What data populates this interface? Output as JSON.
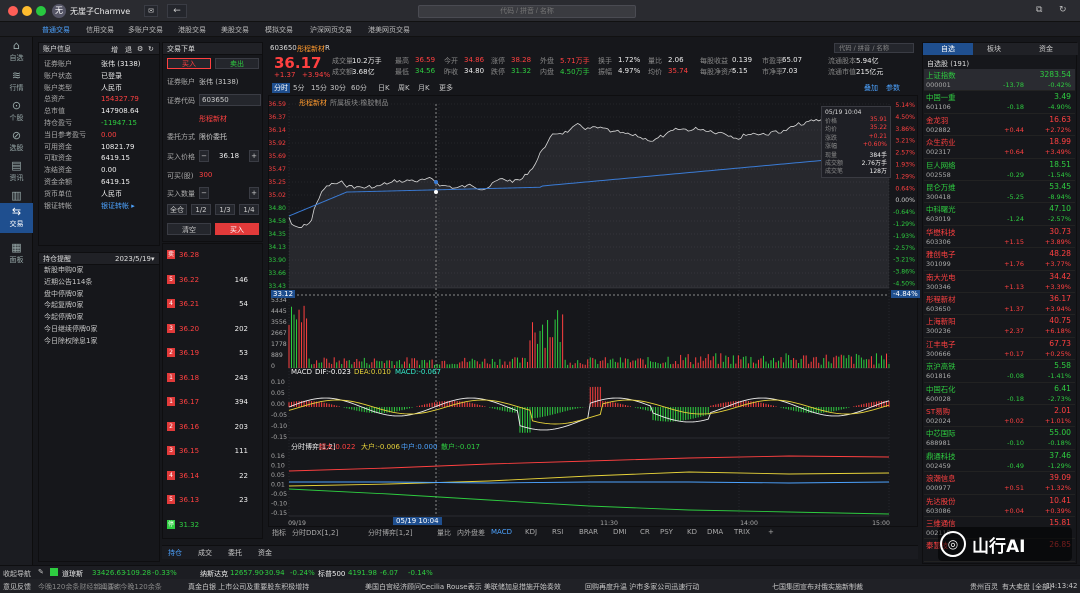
{
  "titlebar": {
    "user": "无崖子Charmve",
    "search_placeholder": "代码 / 拼音 / 名称"
  },
  "nav_tabs": [
    "普通交易",
    "信用交易",
    "多账户交易",
    "港股交易",
    "美股交易",
    "模拟交易",
    "沪深网页交易",
    "港美网页交易"
  ],
  "rail": [
    {
      "icon": "⌂",
      "label": "自选"
    },
    {
      "icon": "≋",
      "label": "行情"
    },
    {
      "icon": "⊙",
      "label": "个股"
    },
    {
      "icon": "⊘",
      "label": "选股"
    },
    {
      "icon": "▤",
      "label": "资讯"
    },
    {
      "icon": "▥",
      "label": "数据"
    },
    {
      "icon": "⇆",
      "label": "交易"
    },
    {
      "icon": "▦",
      "label": "面板"
    }
  ],
  "account": {
    "title": "账户信息",
    "actions": [
      "增",
      "退"
    ],
    "rows": [
      [
        "证券账户",
        "张伟 (3138)"
      ],
      [
        "账户状态",
        "已登录"
      ],
      [
        "账户类型",
        "人民币"
      ],
      [
        "总资产",
        "154327.79"
      ],
      [
        "总市值",
        "147908.64"
      ],
      [
        "持仓盈亏",
        "-11947.15"
      ],
      [
        "当日参考盈亏",
        "0.00"
      ],
      [
        "可用资金",
        "10821.79"
      ],
      [
        "可取资金",
        "6419.15"
      ],
      [
        "冻结资金",
        "0.00"
      ],
      [
        "资金余额",
        "6419.15"
      ],
      [
        "货币单位",
        "人民币"
      ],
      [
        "银证转帐",
        "银证转帐 ▸"
      ]
    ]
  },
  "reminders": {
    "title": "持仓提醒",
    "date": "2023/5/19",
    "items": [
      "新股申购0家",
      "近期公告114条",
      "盘中停牌0家",
      "今起复牌0家",
      "今起停牌0家",
      "今日继续停牌0家",
      "今日除权除息1家"
    ]
  },
  "order": {
    "title": "交易下单",
    "buy_tab": "买入",
    "sell_tab": "卖出",
    "account_label": "证券账户",
    "account": "张伟 (3138)",
    "code_label": "证券代码",
    "code": "603650",
    "name": "彤程新材",
    "type_label": "委托方式",
    "type": "限价委托",
    "price_label": "买入价格",
    "price": "36.18",
    "avail_label": "可买(股)",
    "avail": "300",
    "qty_label": "买入数量",
    "qty_btns": [
      "全仓",
      "1/2",
      "1/3",
      "1/4"
    ],
    "clear": "清空",
    "submit": "买入"
  },
  "orderbook": [
    {
      "q": "卖",
      "p": "36.28",
      "v": "",
      "c": "red"
    },
    {
      "q": "5",
      "p": "36.22",
      "v": "146",
      "c": "red"
    },
    {
      "q": "4",
      "p": "36.21",
      "v": "54",
      "c": "red"
    },
    {
      "q": "3",
      "p": "36.20",
      "v": "202",
      "c": "red"
    },
    {
      "q": "2",
      "p": "36.19",
      "v": "53",
      "c": "red"
    },
    {
      "q": "1",
      "p": "36.18",
      "v": "243",
      "c": "red"
    },
    {
      "q": "1",
      "p": "36.17",
      "v": "394",
      "c": "red"
    },
    {
      "q": "2",
      "p": "36.16",
      "v": "203",
      "c": "red"
    },
    {
      "q": "3",
      "p": "36.15",
      "v": "111",
      "c": "red"
    },
    {
      "q": "4",
      "p": "36.14",
      "v": "22",
      "c": "red"
    },
    {
      "q": "5",
      "p": "36.13",
      "v": "23",
      "c": "red"
    },
    {
      "q": "停",
      "p": "31.32",
      "v": "",
      "c": "green"
    }
  ],
  "quote": {
    "code": "603650",
    "name": "彤程新材",
    "suffix": "R",
    "price": "36.17",
    "change": "+1.37",
    "pct": "+3.94%",
    "fields": [
      [
        "成交量",
        "10.2万手"
      ],
      [
        "最高",
        "36.59"
      ],
      [
        "今开",
        "34.86"
      ],
      [
        "涨停",
        "38.28"
      ],
      [
        "外盘",
        "5.71万手"
      ],
      [
        "换手",
        "1.72%"
      ],
      [
        "量比",
        "2.06"
      ],
      [
        "每股收益",
        "0.139"
      ],
      [
        "市盈率",
        "65.07"
      ],
      [
        "流通股本",
        "5.94亿"
      ],
      [
        "成交额",
        "3.68亿"
      ],
      [
        "最低",
        "34.56"
      ],
      [
        "昨收",
        "34.80"
      ],
      [
        "跌停",
        "31.32"
      ],
      [
        "内盘",
        "4.50万手"
      ],
      [
        "振幅",
        "4.97%"
      ],
      [
        "均价",
        "35.74"
      ],
      [
        "每股净资产",
        "5.15"
      ],
      [
        "市净率",
        "7.03"
      ],
      [
        "流通市值",
        "215亿元"
      ]
    ]
  },
  "periods": [
    "分时",
    "5分",
    "15分",
    "30分",
    "60分",
    "日K",
    "周K",
    "月K",
    "更多"
  ],
  "chart_links": [
    "叠加",
    "参数"
  ],
  "chart_title": "彤程新材",
  "chart_subtitle": "所属板块:橡胶制品",
  "tooltip": {
    "date": "05/19 10:04",
    "rows": [
      [
        "价格",
        "35.91"
      ],
      [
        "均价",
        "35.22"
      ],
      [
        "涨跌",
        "+0.21"
      ],
      [
        "涨幅",
        "+0.60%"
      ],
      [
        "现量",
        "384手"
      ],
      [
        "成交额",
        "2.76万手"
      ],
      [
        "成交笔",
        "128万"
      ]
    ]
  },
  "price_ticks": [
    "36.59",
    "36.37",
    "36.14",
    "35.92",
    "35.69",
    "35.47",
    "35.25",
    "35.02",
    "34.80",
    "34.58",
    "34.35",
    "34.13",
    "33.90",
    "33.66",
    "33.43"
  ],
  "pct_ticks": [
    "5.14%",
    "4.50%",
    "3.86%",
    "3.21%",
    "2.57%",
    "1.93%",
    "1.29%",
    "0.64%",
    "0.00%",
    "-0.64%",
    "-1.29%",
    "-1.93%",
    "-2.57%",
    "-3.21%",
    "-3.86%",
    "-4.50%"
  ],
  "cursor_price": "33.12",
  "cursor_pct": "-4.84%",
  "vol_ticks": [
    "5334",
    "4445",
    "3556",
    "2667",
    "1778",
    "889",
    "0"
  ],
  "macd": {
    "label": "MACD",
    "dif": "DIF:-0.023",
    "dea": "DEA:0.010",
    "macd": "MACD:-0.067",
    "ticks": [
      "0.10",
      "0.05",
      "0.00",
      "-0.05",
      "-0.10",
      "-0.15"
    ]
  },
  "fund": {
    "label": "分时博弈[1,2]",
    "a": "超大:0.022",
    "b": "大户:-0.006",
    "c": "中户:0.000",
    "d": "散户:-0.017",
    "ticks": [
      "0.16",
      "0.10",
      "0.05",
      "0.01",
      "-0.05",
      "-0.10",
      "-0.15"
    ]
  },
  "time_axis": [
    "09/19",
    "10:04",
    "11:30",
    "14:00",
    "15:00"
  ],
  "time_cursor": "05/19 10:04",
  "indicator_tabs": [
    "指标",
    "分时DDX[1,2]",
    "分时博弈[1,2]",
    "量比",
    "内外盘差",
    "MACD",
    "KDJ",
    "RSI",
    "BRAR",
    "DMI",
    "CR",
    "PSY",
    "KD",
    "DMA",
    "TRIX",
    "+"
  ],
  "bottom_tabs": [
    "持仓",
    "成交",
    "委托",
    "资金"
  ],
  "watchlist": {
    "tabs": [
      "自选",
      "板块",
      "资金"
    ],
    "group": "自选股 (191)",
    "items": [
      {
        "n": "上证指数",
        "c": "000001",
        "p": "3283.54",
        "d": "-13.78",
        "r": "-0.42%",
        "col": "green"
      },
      {
        "n": "中国一重",
        "c": "601106",
        "p": "3.49",
        "d": "-0.18",
        "r": "-4.90%",
        "col": "green"
      },
      {
        "n": "金龙羽",
        "c": "002882",
        "p": "16.63",
        "d": "+0.44",
        "r": "+2.72%",
        "col": "red"
      },
      {
        "n": "众生药业",
        "c": "002317",
        "p": "18.99",
        "d": "+0.64",
        "r": "+3.49%",
        "col": "red"
      },
      {
        "n": "巨人网络",
        "c": "002558",
        "p": "18.51",
        "d": "-0.29",
        "r": "-1.54%",
        "col": "green"
      },
      {
        "n": "昆仑万维",
        "c": "300418",
        "p": "53.45",
        "d": "-5.25",
        "r": "-8.94%",
        "col": "green"
      },
      {
        "n": "中科曙光",
        "c": "603019",
        "p": "47.10",
        "d": "-1.24",
        "r": "-2.57%",
        "col": "green"
      },
      {
        "n": "华懋科技",
        "c": "603306",
        "p": "30.73",
        "d": "+1.15",
        "r": "+3.89%",
        "col": "red"
      },
      {
        "n": "雅创电子",
        "c": "301099",
        "p": "48.28",
        "d": "+1.76",
        "r": "+3.77%",
        "col": "red"
      },
      {
        "n": "南大光电",
        "c": "300346",
        "p": "34.42",
        "d": "+1.13",
        "r": "+3.39%",
        "col": "red"
      },
      {
        "n": "彤程新材",
        "c": "603650",
        "p": "36.17",
        "d": "+1.37",
        "r": "+3.94%",
        "col": "red"
      },
      {
        "n": "上海新阳",
        "c": "300236",
        "p": "40.75",
        "d": "+2.37",
        "r": "+6.18%",
        "col": "red"
      },
      {
        "n": "江丰电子",
        "c": "300666",
        "p": "67.73",
        "d": "+0.17",
        "r": "+0.25%",
        "col": "red"
      },
      {
        "n": "京沪高铁",
        "c": "601816",
        "p": "5.58",
        "d": "-0.08",
        "r": "-1.41%",
        "col": "green"
      },
      {
        "n": "中国石化",
        "c": "600028",
        "p": "6.41",
        "d": "-0.18",
        "r": "-2.73%",
        "col": "green"
      },
      {
        "n": "ST易购",
        "c": "002024",
        "p": "2.01",
        "d": "+0.02",
        "r": "+1.01%",
        "col": "red"
      },
      {
        "n": "中芯国际",
        "c": "688981",
        "p": "55.00",
        "d": "-0.10",
        "r": "-0.18%",
        "col": "green"
      },
      {
        "n": "鼎通科技",
        "c": "002459",
        "p": "37.46",
        "d": "-0.49",
        "r": "-1.29%",
        "col": "green"
      },
      {
        "n": "浪潮信息",
        "c": "000977",
        "p": "39.09",
        "d": "+0.51",
        "r": "+1.32%",
        "col": "red"
      },
      {
        "n": "先达股份",
        "c": "603086",
        "p": "10.41",
        "d": "+0.04",
        "r": "+0.39%",
        "col": "red"
      },
      {
        "n": "三维通信",
        "c": "002115",
        "p": "15.81",
        "d": "",
        "r": "",
        "col": "red"
      },
      {
        "n": "泰慧技",
        "c": "",
        "p": "26.85",
        "d": "",
        "r": "",
        "col": "red"
      }
    ]
  },
  "watermark": "山行AI",
  "statusbar": {
    "label": "收起导航",
    "indices": [
      [
        "道琼斯",
        "33426.63",
        "-109.28",
        "-0.33%"
      ],
      [
        "纳斯达克",
        "12657.90",
        "-30.94",
        "-0.24%"
      ],
      [
        "标普500",
        "4191.98",
        "-6.07",
        "-0.14%"
      ]
    ]
  },
  "ticker": {
    "label": "意见反馈",
    "items": [
      "21:18 今晚120余条",
      "21:16 上市公司及重要股东",
      "20:53 回购",
      "13:56 七国集团",
      "13:54 日本内阁",
      "贵州百灵",
      "有大卖盘 [全部]"
    ],
    "news": [
      "今晚120余条财经新闻要点",
      "真金白银 上市公司及重要股东积极增持",
      "美国白宫经济顾问Cecilia Rouse表示 美联储加息措施开始奏效",
      "回购再度升温 沪市多家公司迅速行动",
      "七国集团宣布对俄实施新制裁",
      "日本内阁"
    ],
    "time": "14:13:42"
  },
  "colors": {
    "up": "#ff4040",
    "down": "#2ecc40",
    "accent": "#1f4f8f",
    "bg": "#16171b",
    "price_line": "#d8d8d8",
    "avg_line": "#3a7bd5"
  }
}
